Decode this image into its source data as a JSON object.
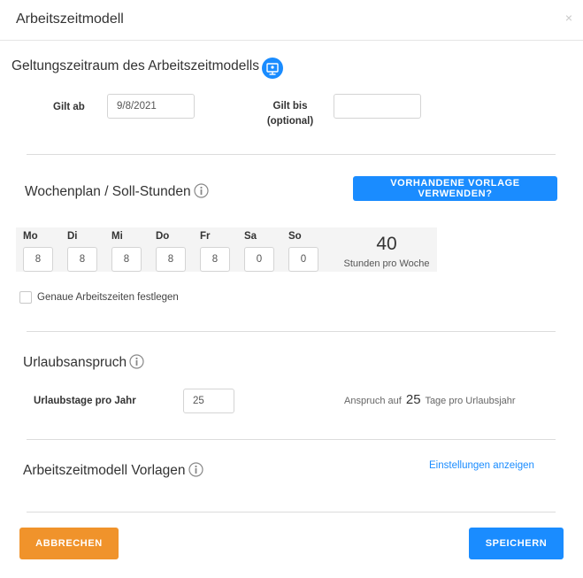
{
  "header": {
    "title": "Arbeitszeitmodell",
    "close_glyph": "×"
  },
  "validity": {
    "title": "Geltungszeitraum des Arbeitszeitmodells",
    "icon": "calendar-badge-icon",
    "from_label": "Gilt ab",
    "from_value": "9/8/2021",
    "to_label_line1": "Gilt bis",
    "to_label_line2": "(optional)",
    "to_value": ""
  },
  "weekplan": {
    "title": "Wochenplan / Soll-Stunden",
    "template_button": "VORHANDENE VORLAGE VERWENDEN?",
    "days": [
      {
        "name": "Mo",
        "hours": "8"
      },
      {
        "name": "Di",
        "hours": "8"
      },
      {
        "name": "Mi",
        "hours": "8"
      },
      {
        "name": "Do",
        "hours": "8"
      },
      {
        "name": "Fr",
        "hours": "8"
      },
      {
        "name": "Sa",
        "hours": "0"
      },
      {
        "name": "So",
        "hours": "0"
      }
    ],
    "total": "40",
    "total_unit": "Stunden pro Woche",
    "exact_times_label": "Genaue Arbeitszeiten festlegen",
    "exact_times_checked": false
  },
  "vacation": {
    "title": "Urlaubsanspruch",
    "days_label": "Urlaubstage pro Jahr",
    "days_value": "25",
    "claim_prefix": "Anspruch auf",
    "claim_days": "25",
    "claim_suffix": "Tage pro Urlaubsjahr"
  },
  "templates": {
    "title": "Arbeitszeitmodell Vorlagen",
    "settings_link": "Einstellungen anzeigen"
  },
  "footer": {
    "cancel": "ABBRECHEN",
    "save": "SPEICHERN"
  },
  "colors": {
    "primary": "#1a8cff",
    "cancel": "#f0932b"
  }
}
